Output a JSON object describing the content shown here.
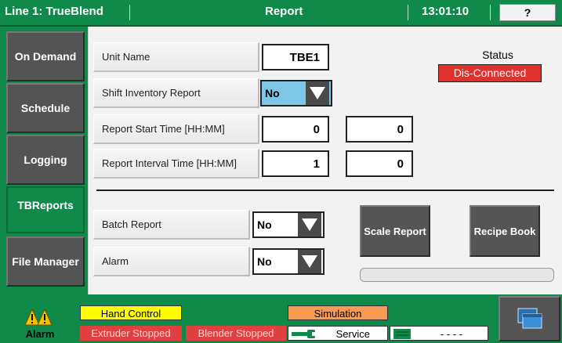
{
  "header": {
    "line_title": "Line 1: TrueBlend",
    "screen_title": "Report",
    "time": "13:01:10",
    "help_label": "?"
  },
  "sidebar": {
    "items": [
      {
        "label": "On Demand",
        "active": false
      },
      {
        "label": "Schedule",
        "active": false
      },
      {
        "label": "Logging",
        "active": false
      },
      {
        "label": "TBReports",
        "active": true
      },
      {
        "label": "File Manager",
        "active": false
      }
    ]
  },
  "form": {
    "unit_name": {
      "label": "Unit Name",
      "value": "TBE1"
    },
    "shift_inventory": {
      "label": "Shift Inventory Report",
      "value": "No"
    },
    "start_time": {
      "label": "Report Start Time [HH:MM]",
      "hours": "0",
      "minutes": "0"
    },
    "interval_time": {
      "label": "Report Interval Time [HH:MM]",
      "hours": "1",
      "minutes": "0"
    },
    "batch_report": {
      "label": "Batch Report",
      "value": "No"
    },
    "alarm": {
      "label": "Alarm",
      "value": "No"
    }
  },
  "status": {
    "title": "Status",
    "value": "Dis-Connected",
    "color": "#e0322c"
  },
  "actions": {
    "scale_report": "Scale Report",
    "recipe_book": "Recipe Book"
  },
  "progress": {
    "fraction": 0
  },
  "footer": {
    "alarm_label": "Alarm",
    "hand_control": "Hand Control",
    "simulation": "Simulation",
    "extruder_stopped": "Extruder Stopped",
    "blender_stopped": "Blender Stopped",
    "service": "Service",
    "dashes": "- - - -"
  },
  "colors": {
    "brand_green": "#0f8a4a",
    "hand_control_bg": "#ffff00",
    "simulation_bg": "#f79a52",
    "stopped_bg": "#e04040",
    "select_highlight": "#7dc6e6"
  },
  "icons": {
    "alarm": "warning-triangle-icon",
    "service": "wrench-icon",
    "status_light": "green-indicator-icon",
    "screen": "window-switch-icon"
  }
}
